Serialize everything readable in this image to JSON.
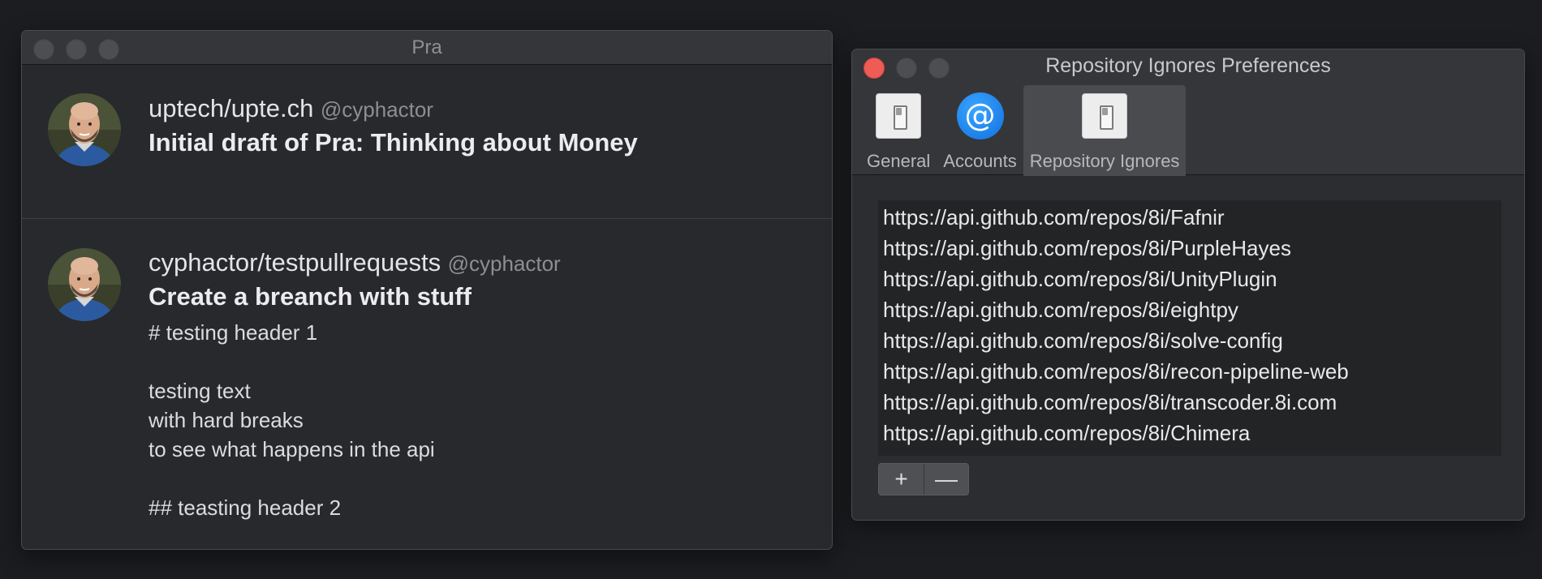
{
  "pra_window": {
    "title": "Pra",
    "items": [
      {
        "repo": "uptech/upte.ch",
        "handle": "@cyphactor",
        "title": "Initial draft of Pra: Thinking about Money",
        "body": ""
      },
      {
        "repo": "cyphactor/testpullrequests",
        "handle": "@cyphactor",
        "title": "Create a breanch with stuff",
        "body": "# testing header 1\n\ntesting text\nwith hard breaks\nto see what happens in the api\n\n## teasting header 2"
      }
    ]
  },
  "prefs_window": {
    "title": "Repository Ignores Preferences",
    "tabs": [
      {
        "label": "General",
        "icon": "switch-icon"
      },
      {
        "label": "Accounts",
        "icon": "at-icon",
        "glyph": "@"
      },
      {
        "label": "Repository Ignores",
        "icon": "switch-icon",
        "active": true
      }
    ],
    "ignores": [
      "https://api.github.com/repos/8i/Fafnir",
      "https://api.github.com/repos/8i/PurpleHayes",
      "https://api.github.com/repos/8i/UnityPlugin",
      "https://api.github.com/repos/8i/eightpy",
      "https://api.github.com/repos/8i/solve-config",
      "https://api.github.com/repos/8i/recon-pipeline-web",
      "https://api.github.com/repos/8i/transcoder.8i.com",
      "https://api.github.com/repos/8i/Chimera"
    ],
    "add_label": "+",
    "remove_label": "—"
  },
  "colors": {
    "desktop": "#1c1d20",
    "close_button": "#ee5c55",
    "accounts_icon": "#1f8bf5"
  }
}
